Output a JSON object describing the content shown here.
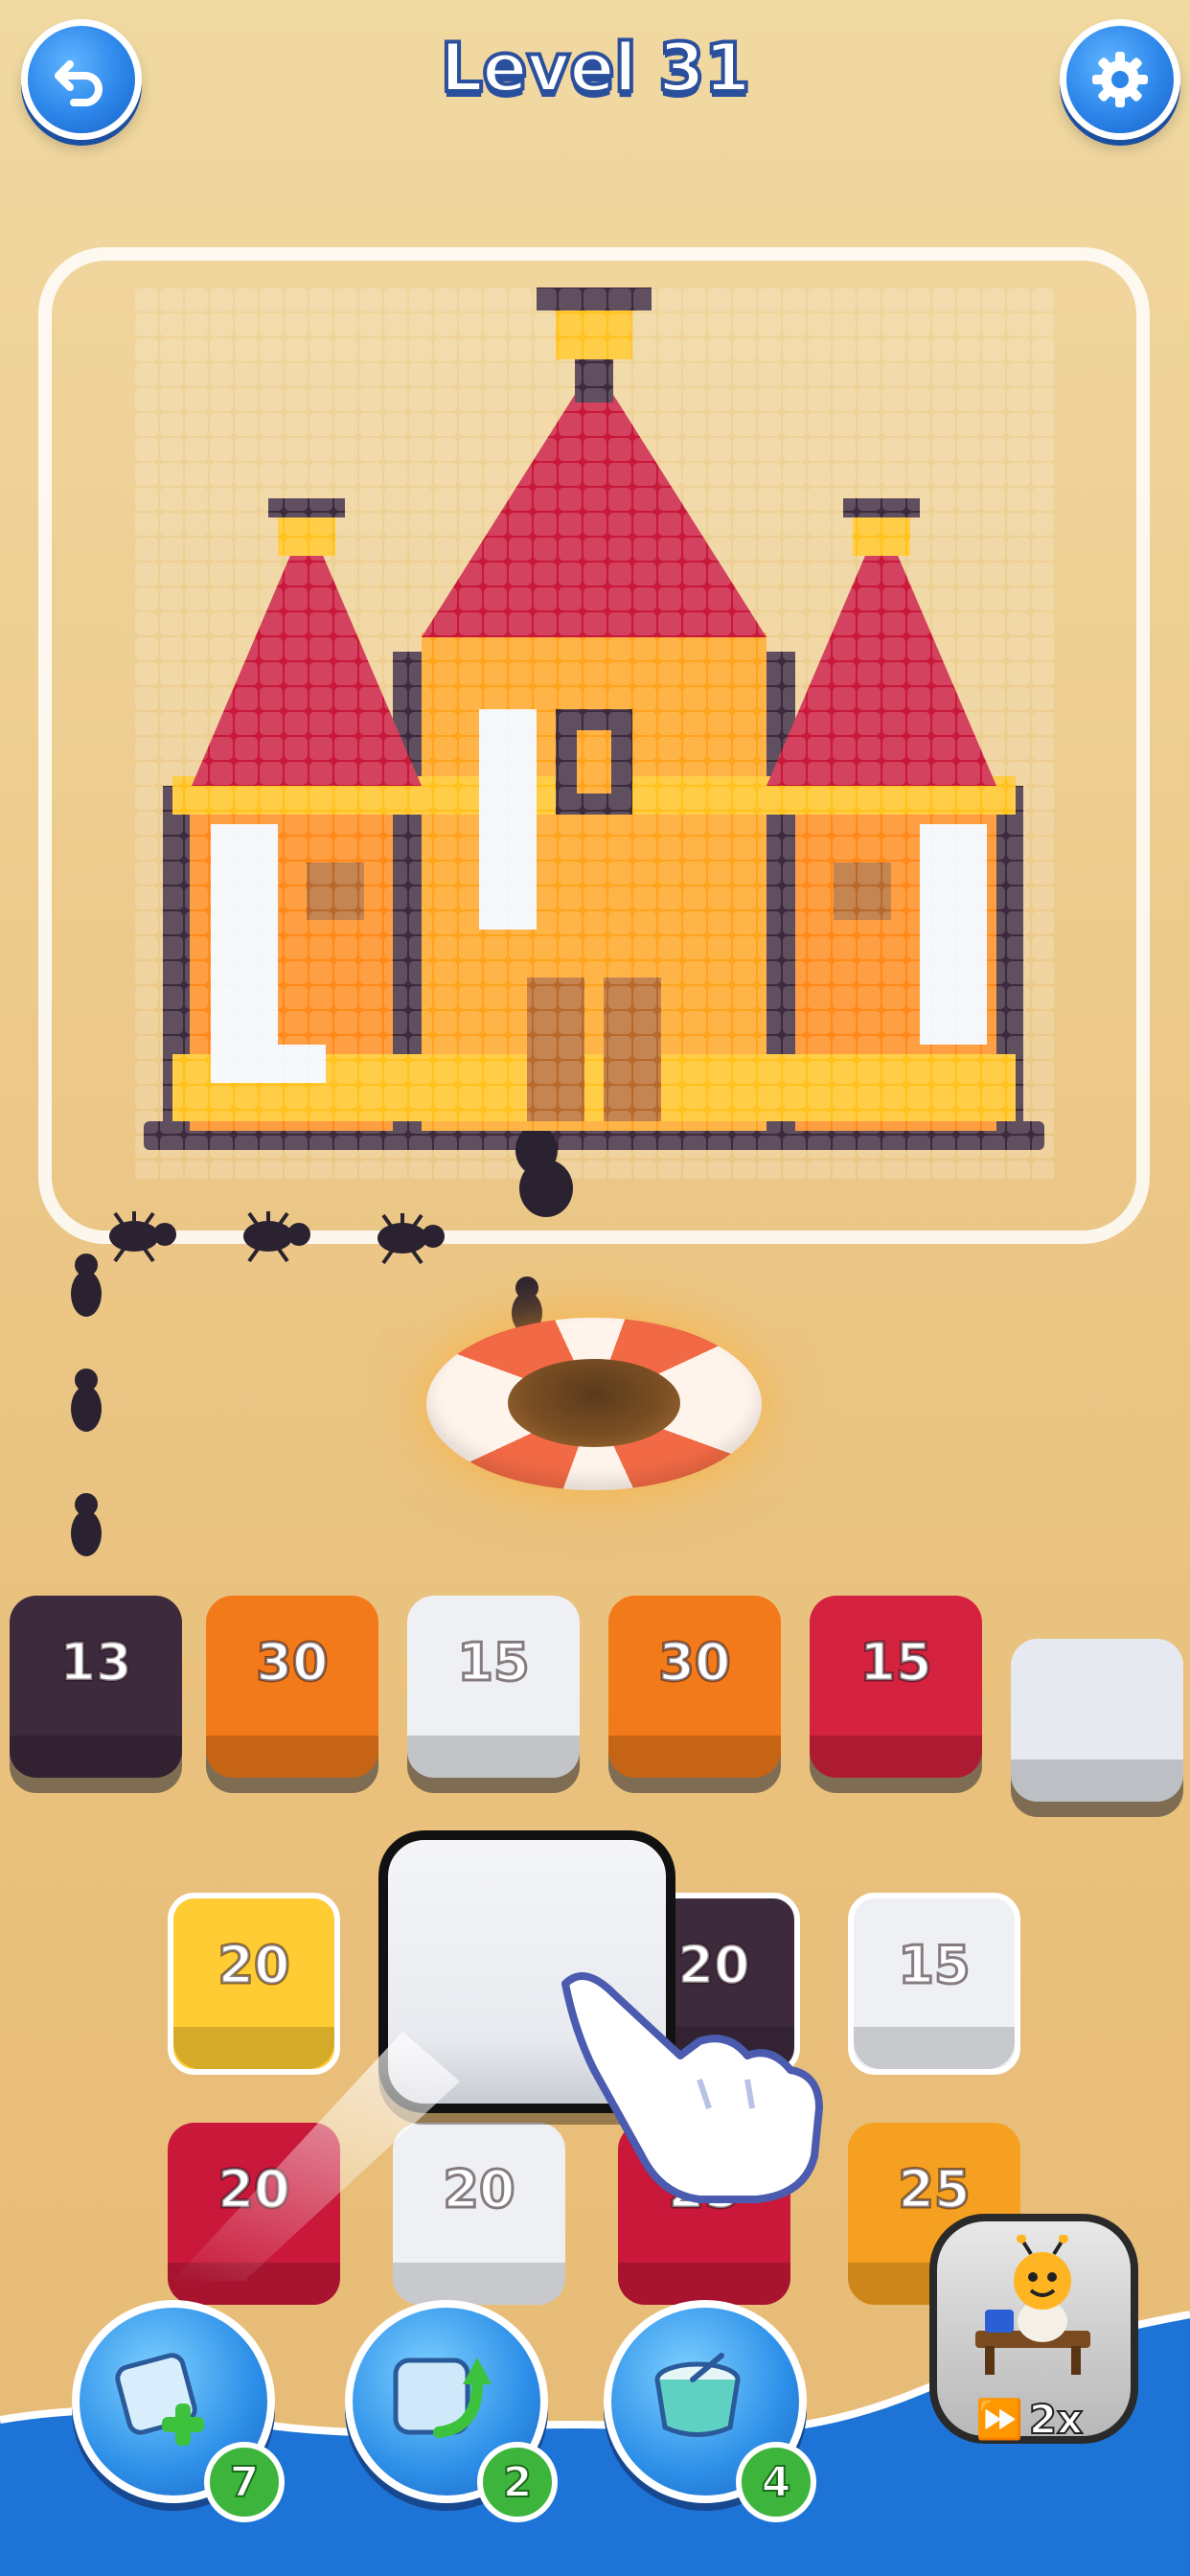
{
  "header": {
    "title": "Level 31",
    "undo_icon": "undo-arrow-icon",
    "settings_icon": "gear-icon"
  },
  "colors": {
    "dark": "#3d2a3c",
    "red": "#c9183a",
    "orange": "#ff8a1a",
    "yellow": "#ffc21e",
    "white": "#f4f6fa",
    "brown": "#b86a2c",
    "accent_blue": "#2c86ea"
  },
  "queue": [
    {
      "value": "13",
      "color": "#3d2a3c"
    },
    {
      "value": "30",
      "color": "#f27a1a"
    },
    {
      "value": "15",
      "color": "#eef0f3"
    },
    {
      "value": "30",
      "color": "#f27a1a"
    },
    {
      "value": "15",
      "color": "#d4223f"
    },
    {
      "value": "",
      "color": "#e6e9ef"
    }
  ],
  "board": [
    {
      "value": "20",
      "color": "#ffcc33"
    },
    {
      "value": "20",
      "color": "#3d2a3c"
    },
    {
      "value": "15",
      "color": "#eef0f3"
    },
    {
      "value": "20",
      "color": "#c9183a"
    },
    {
      "value": "20",
      "color": "#eef0f3"
    },
    {
      "value": "25",
      "color": "#c9183a"
    },
    {
      "value": "25",
      "color": "#f5a020"
    }
  ],
  "powerups": [
    {
      "name": "add-tile",
      "icon": "add-tile-icon",
      "count": "7"
    },
    {
      "name": "shuffle",
      "icon": "ice-cube-arrow-icon",
      "count": "2"
    },
    {
      "name": "clear",
      "icon": "bowl-icon",
      "count": "4"
    }
  ],
  "speed": {
    "label": "2x",
    "icon": "fast-forward-icon"
  }
}
